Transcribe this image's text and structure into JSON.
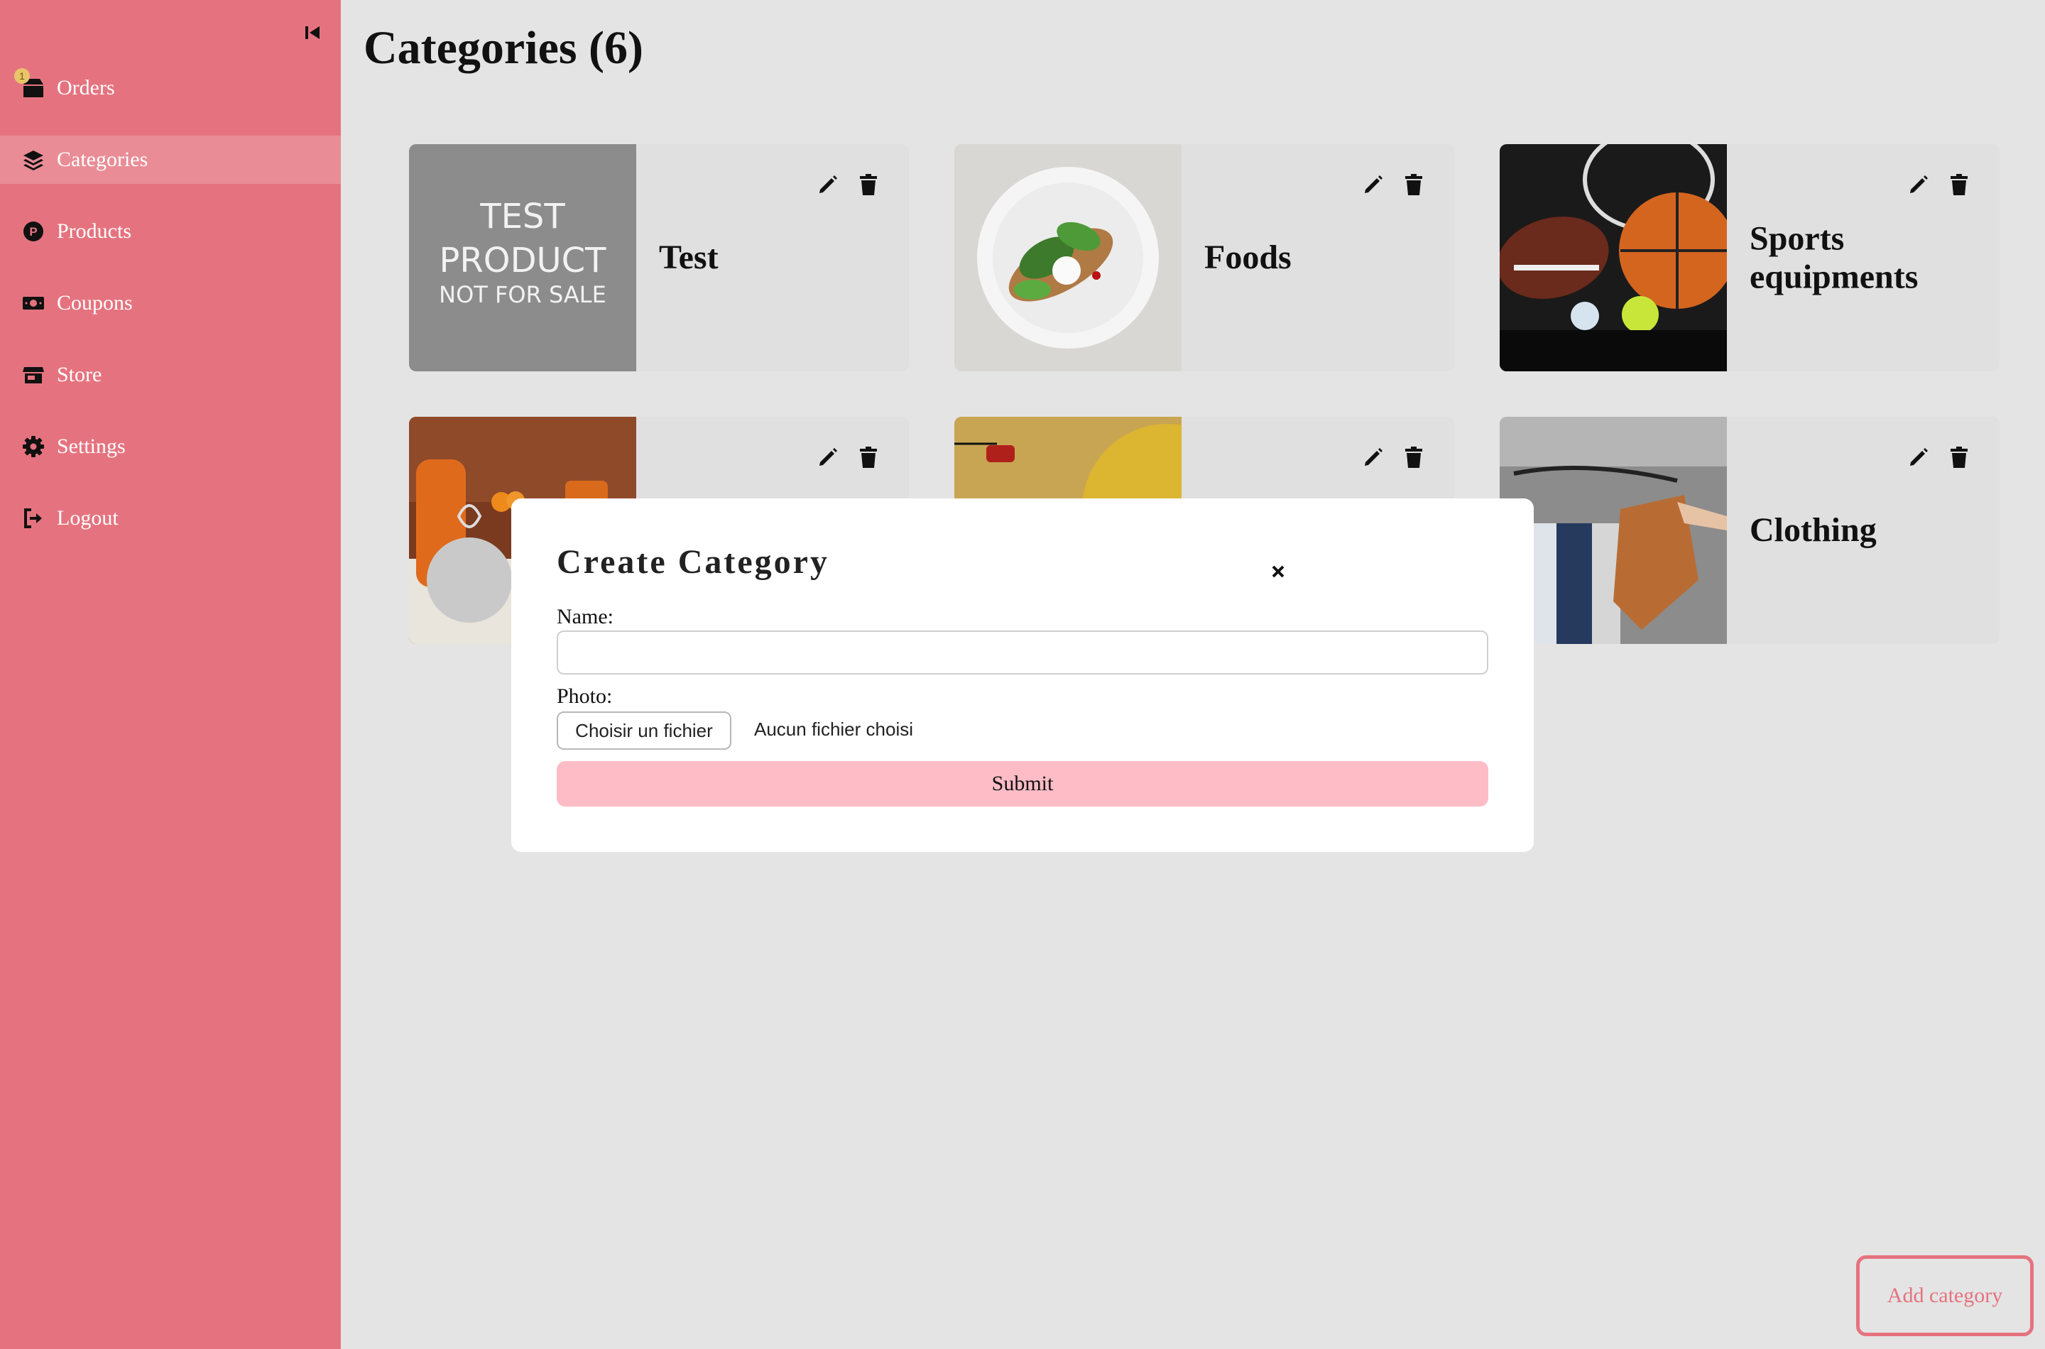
{
  "sidebar": {
    "collapse_icon": "collapse-left-icon",
    "items": [
      {
        "label": "Orders",
        "icon": "box-icon",
        "badge": "1"
      },
      {
        "label": "Categories",
        "icon": "layers-icon",
        "active": true
      },
      {
        "label": "Products",
        "icon": "product-circle-icon"
      },
      {
        "label": "Coupons",
        "icon": "money-icon"
      },
      {
        "label": "Store",
        "icon": "store-icon"
      },
      {
        "label": "Settings",
        "icon": "gear-icon"
      },
      {
        "label": "Logout",
        "icon": "logout-icon"
      }
    ]
  },
  "main": {
    "title": "Categories (6)",
    "categories": [
      {
        "name": "Test",
        "thumb": {
          "line1": "TEST",
          "line2": "PRODUCT",
          "line3": "NOT FOR SALE"
        }
      },
      {
        "name": "Foods"
      },
      {
        "name": "Sports equipments"
      },
      {
        "name": ""
      },
      {
        "name": ""
      },
      {
        "name": "Clothing"
      }
    ],
    "add_label": "Add category"
  },
  "modal": {
    "title": "Create Category",
    "close_icon": "close-icon",
    "name_label": "Name:",
    "name_value": "",
    "photo_label": "Photo:",
    "file_button": "Choisir un fichier",
    "file_status": "Aucun fichier choisi",
    "submit_label": "Submit"
  },
  "colors": {
    "sidebar": "#e5737f",
    "background": "#e4e4e4",
    "submit": "#fdbcc6",
    "card": "#e0e0e0"
  }
}
